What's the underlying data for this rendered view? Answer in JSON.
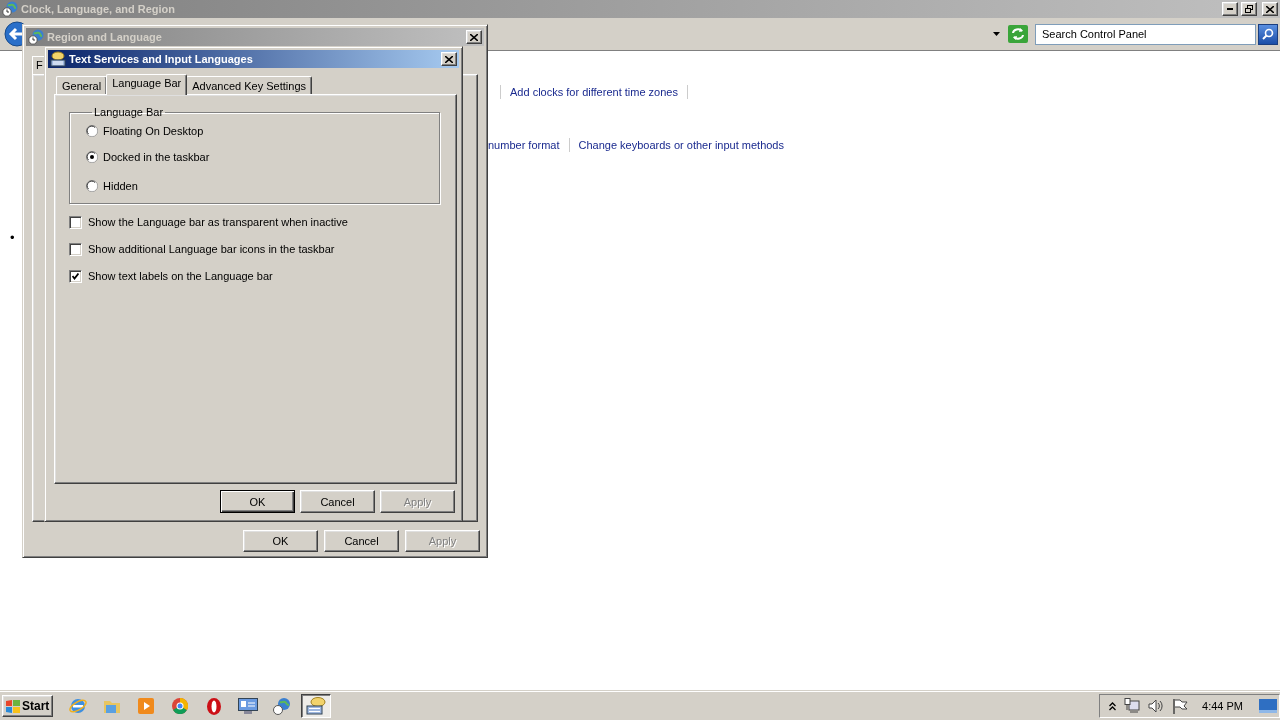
{
  "main_window": {
    "title": "Clock, Language, and Region",
    "active": false,
    "search_placeholder": "Search Control Panel",
    "link_rows": [
      [
        {
          "text": "Add clocks for different time zones"
        }
      ],
      [
        {
          "text": "number format"
        },
        {
          "text": "Change keyboards or other input methods"
        }
      ]
    ],
    "bullet": "•"
  },
  "region_dialog": {
    "title": "Region and Language",
    "active": false,
    "tab_fragment": "F",
    "buttons": [
      {
        "label": "OK",
        "disabled": false,
        "default": false
      },
      {
        "label": "Cancel",
        "disabled": false,
        "default": false
      },
      {
        "label": "Apply",
        "disabled": true,
        "default": false
      }
    ]
  },
  "text_services_dialog": {
    "title": "Text Services and Input Languages",
    "active": true,
    "tabs": [
      {
        "label": "General",
        "selected": false
      },
      {
        "label": "Language Bar",
        "selected": true
      },
      {
        "label": "Advanced Key Settings",
        "selected": false
      }
    ],
    "language_bar_group": {
      "title": "Language Bar",
      "options": [
        {
          "label": "Floating On Desktop",
          "selected": false
        },
        {
          "label": "Docked in the taskbar",
          "selected": true
        },
        {
          "label": "Hidden",
          "selected": false
        }
      ]
    },
    "checkboxes": [
      {
        "label": "Show the Language bar as transparent when inactive",
        "checked": false
      },
      {
        "label": "Show additional Language bar icons in the taskbar",
        "checked": false
      },
      {
        "label": "Show text labels on the Language bar",
        "checked": true
      }
    ],
    "buttons": [
      {
        "label": "OK",
        "disabled": false,
        "default": true
      },
      {
        "label": "Cancel",
        "disabled": false,
        "default": false
      },
      {
        "label": "Apply",
        "disabled": true,
        "default": false
      }
    ]
  },
  "taskbar": {
    "start": "Start",
    "apps": [
      {
        "kind": "ie",
        "selected": false
      },
      {
        "kind": "folder",
        "selected": false
      },
      {
        "kind": "media",
        "selected": false
      },
      {
        "kind": "chrome",
        "selected": false
      },
      {
        "kind": "opera",
        "selected": false
      },
      {
        "kind": "monitor",
        "selected": false
      },
      {
        "kind": "globe",
        "selected": false
      },
      {
        "kind": "keyboard",
        "selected": true
      }
    ],
    "clock": "4:44 PM"
  }
}
